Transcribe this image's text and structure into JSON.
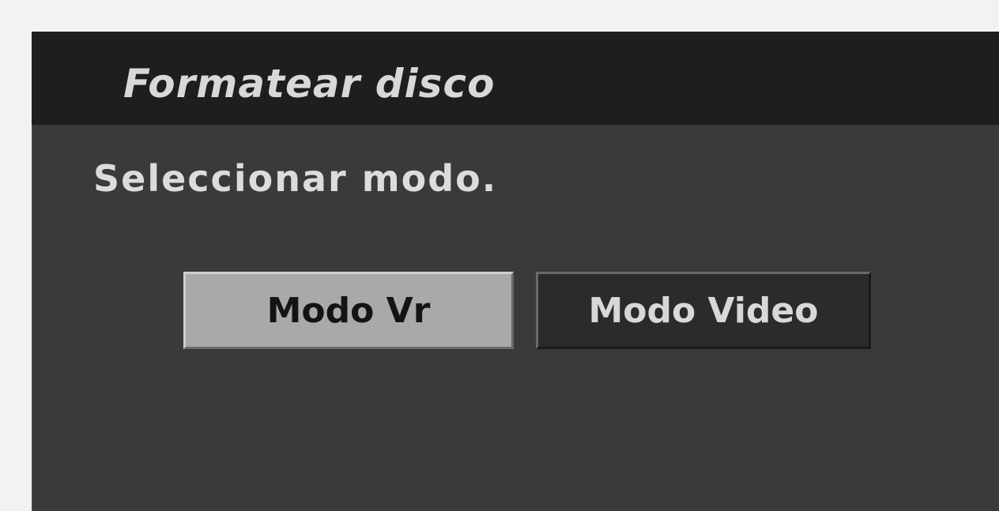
{
  "dialog": {
    "title": "Formatear disco",
    "prompt": "Seleccionar modo.",
    "buttons": [
      {
        "label": "Modo Vr",
        "selected": true
      },
      {
        "label": "Modo Video",
        "selected": false
      }
    ]
  },
  "colors": {
    "panel_background": "#3a3a3a",
    "titlebar_background": "#1e1e1e",
    "selected_button": "#a9a9a9",
    "unselected_button": "#2b2b2b",
    "text_light": "#d8d8d8",
    "text_dark": "#141414"
  }
}
